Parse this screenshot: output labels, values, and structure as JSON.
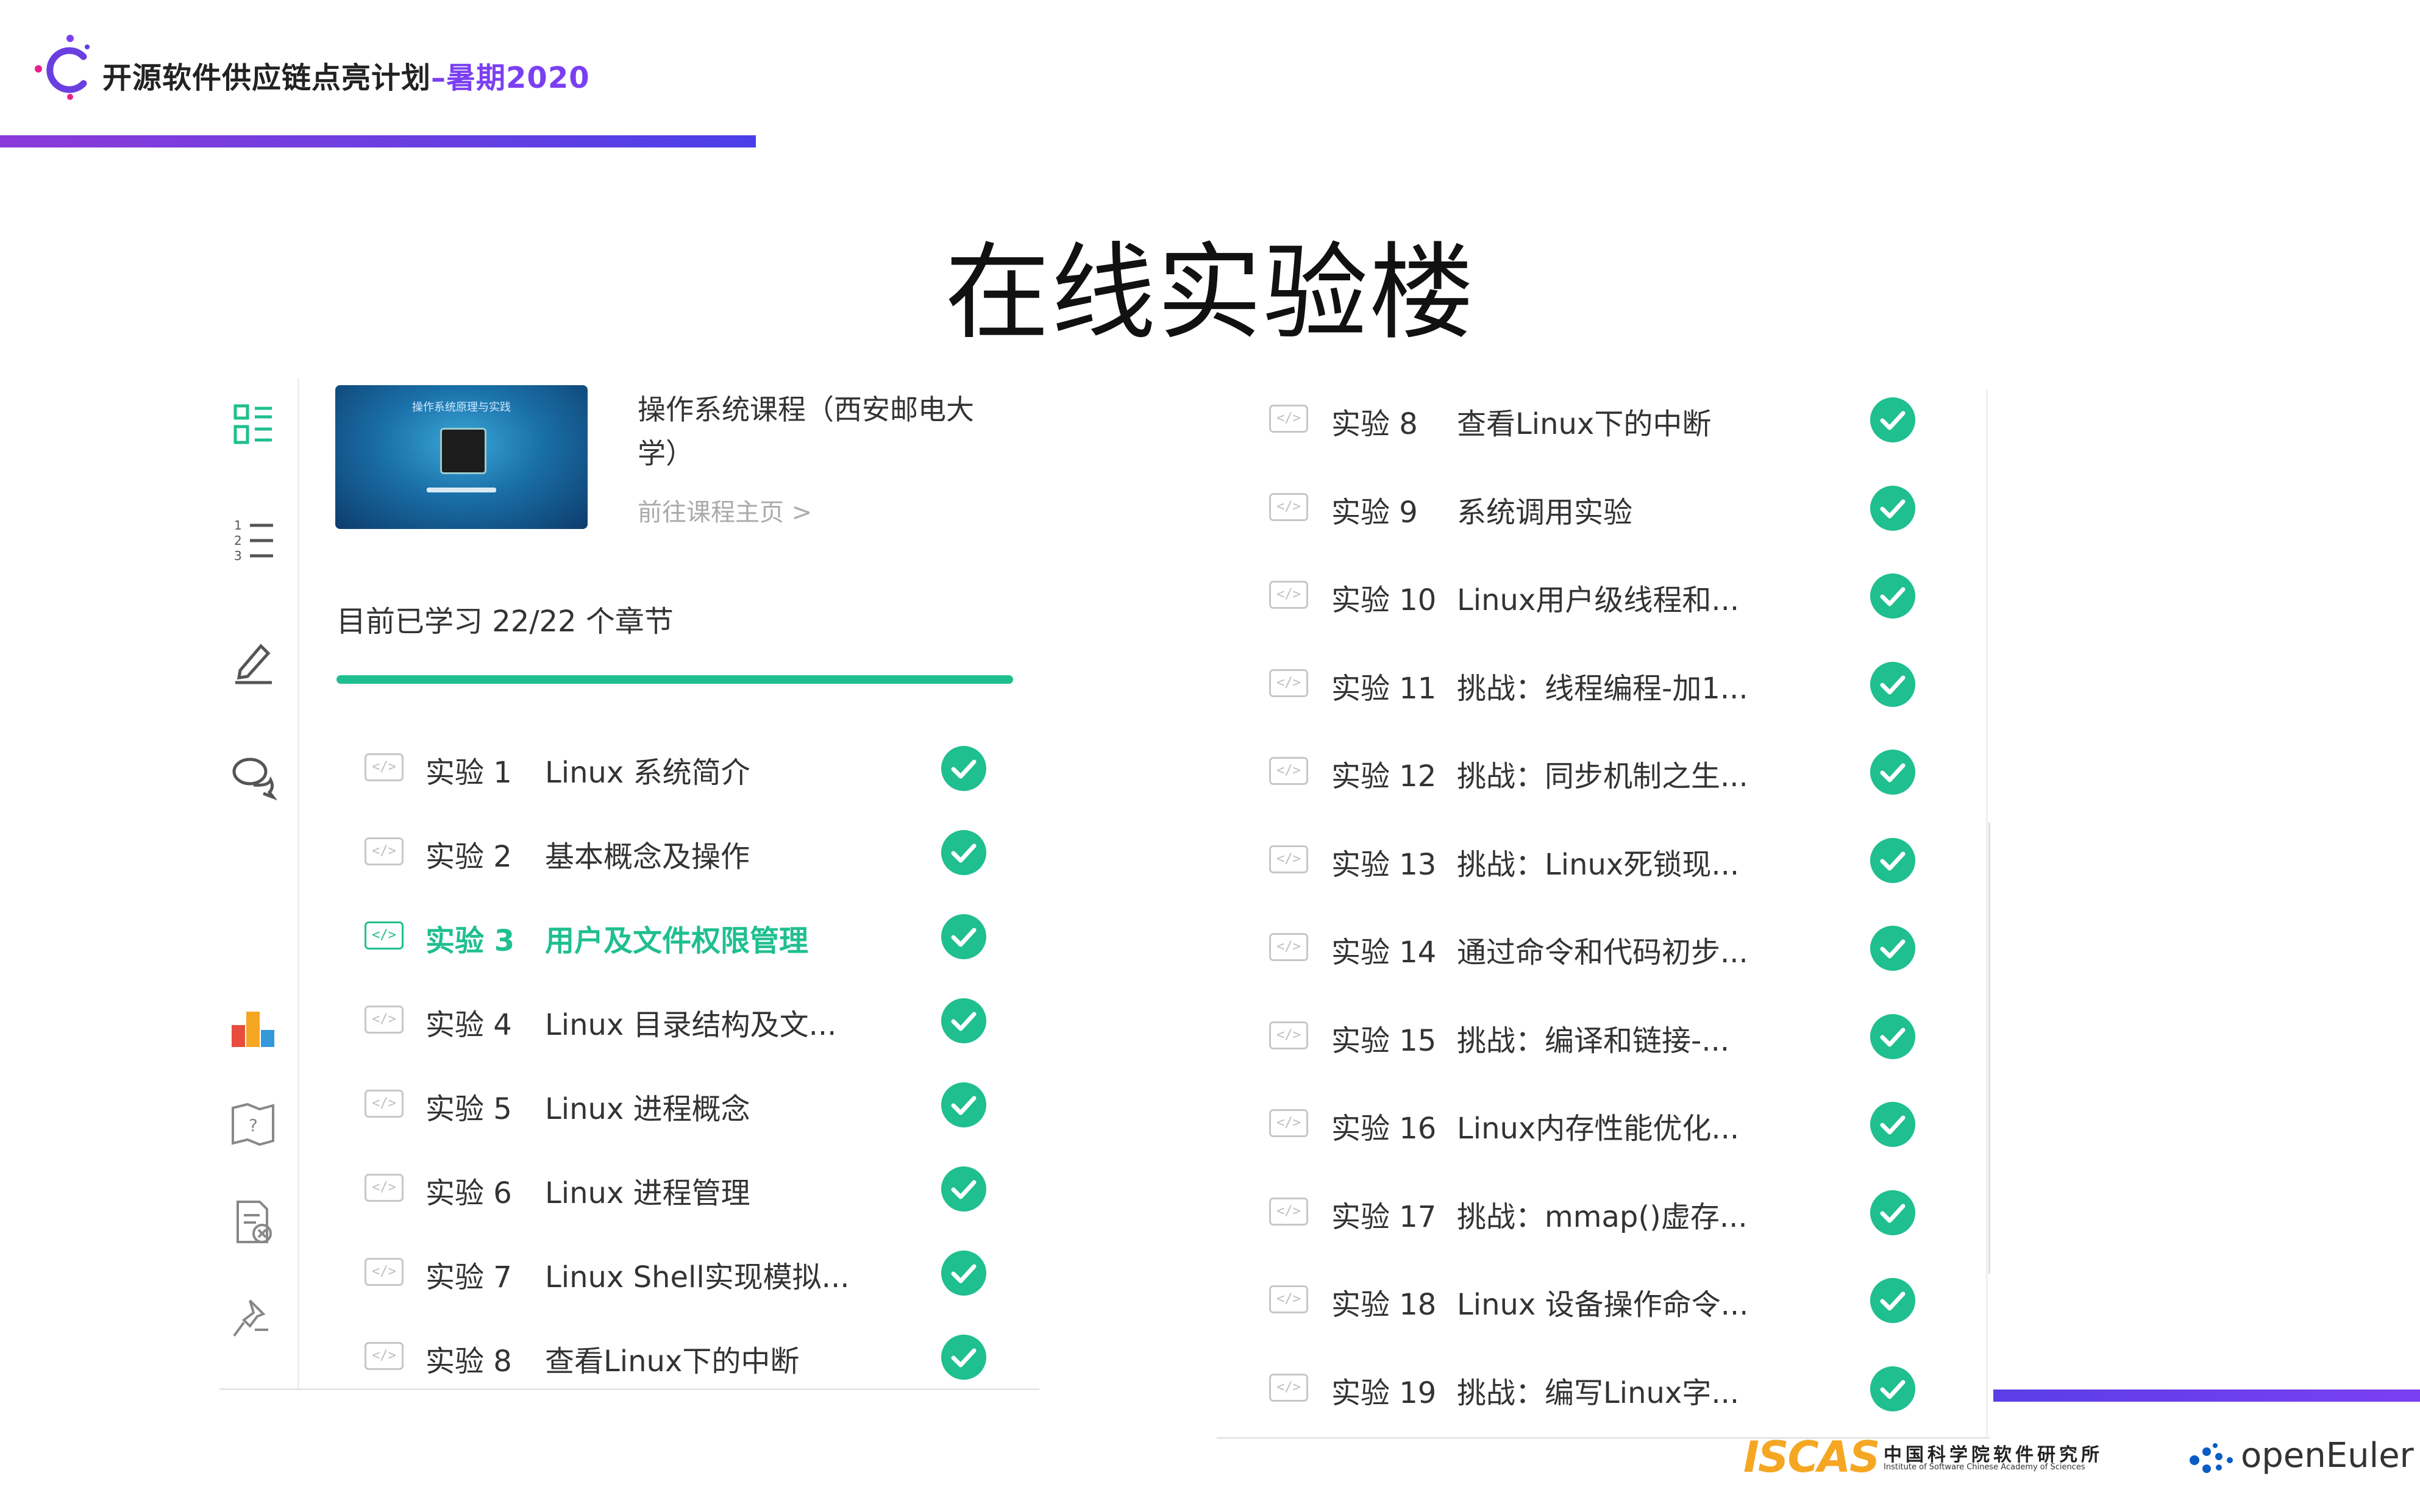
{
  "header": {
    "title_main": "开源软件供应链点亮计划",
    "title_dash": "–",
    "title_accent": "暑期2020"
  },
  "page_title": "在线实验楼",
  "sidebar": {
    "icons": [
      "list-grid-icon",
      "numbered-list-icon",
      "pen-icon",
      "chat-icon",
      "ranking-icon",
      "question-map-icon",
      "report-icon",
      "pin-icon"
    ]
  },
  "course": {
    "thumb_caption": "操作系统原理与实践",
    "name": "操作系统课程（西安邮电大学）",
    "link": "前往课程主页 >"
  },
  "progress": {
    "text": "目前已学习 22/22 个章节",
    "fraction": 1.0
  },
  "colors": {
    "accent": "#1fbf8f",
    "brand_purple": "#7b3ff2"
  },
  "left_list": [
    {
      "num": "实验 1",
      "title": "Linux 系统简介",
      "active": false,
      "done": true
    },
    {
      "num": "实验 2",
      "title": "基本概念及操作",
      "active": false,
      "done": true
    },
    {
      "num": "实验 3",
      "title": "用户及文件权限管理",
      "active": true,
      "done": true
    },
    {
      "num": "实验 4",
      "title": "Linux 目录结构及文...",
      "active": false,
      "done": true
    },
    {
      "num": "实验 5",
      "title": "Linux 进程概念",
      "active": false,
      "done": true
    },
    {
      "num": "实验 6",
      "title": "Linux 进程管理",
      "active": false,
      "done": true
    },
    {
      "num": "实验 7",
      "title": "Linux Shell实现模拟...",
      "active": false,
      "done": true
    },
    {
      "num": "实验 8",
      "title": "查看Linux下的中断",
      "active": false,
      "done": true
    }
  ],
  "right_list": [
    {
      "num": "实验 8",
      "title": "查看Linux下的中断",
      "done": true
    },
    {
      "num": "实验 9",
      "title": "系统调用实验",
      "done": true
    },
    {
      "num": "实验 10",
      "title": "Linux用户级线程和...",
      "done": true
    },
    {
      "num": "实验 11",
      "title": "挑战：线程编程-加1...",
      "done": true
    },
    {
      "num": "实验 12",
      "title": "挑战：同步机制之生...",
      "done": true
    },
    {
      "num": "实验 13",
      "title": "挑战：Linux死锁现...",
      "done": true
    },
    {
      "num": "实验 14",
      "title": "通过命令和代码初步...",
      "done": true
    },
    {
      "num": "实验 15",
      "title": "挑战：编译和链接-...",
      "done": true
    },
    {
      "num": "实验 16",
      "title": "Linux内存性能优化...",
      "done": true
    },
    {
      "num": "实验 17",
      "title": "挑战：mmap()虚存...",
      "done": true
    },
    {
      "num": "实验 18",
      "title": "Linux 设备操作命令...",
      "done": true
    },
    {
      "num": "实验 19",
      "title": "挑战：编写Linux字...",
      "done": true
    }
  ],
  "footer": {
    "iscas_mark": "ISCAS",
    "iscas_cn": "中国科学院软件研究所",
    "iscas_en": "Institute of Software Chinese Academy of Sciences",
    "openeuler": "openEuler"
  }
}
